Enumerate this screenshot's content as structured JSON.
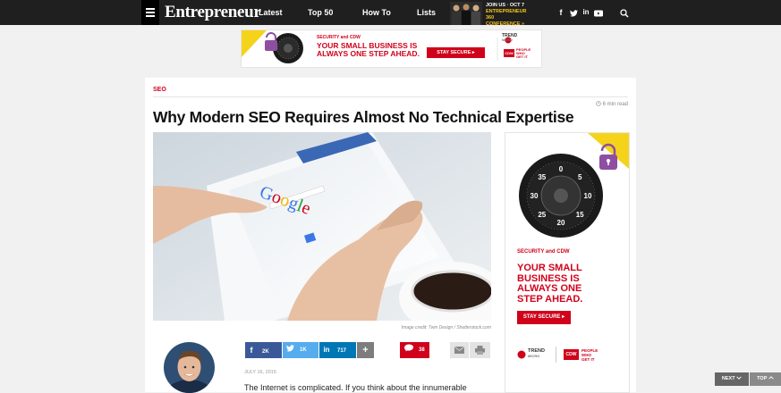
{
  "header": {
    "logo": "Entrepreneur",
    "nav": [
      "Latest",
      "Top 50",
      "How To",
      "Lists"
    ],
    "promo_line1": "JOIN US · OCT 7",
    "promo_line2": "ENTREPRENEUR 360",
    "promo_line3": "CONFERENCE »",
    "social_icons": [
      "facebook-icon",
      "twitter-icon",
      "linkedin-icon",
      "youtube-icon"
    ],
    "search_icon": "search-icon"
  },
  "top_ad": {
    "brand_line": "SECURITY and CDW",
    "headline_1": "YOUR SMALL BUSINESS IS",
    "headline_2": "ALWAYS ONE STEP AHEAD.",
    "cta": "STAY SECURE",
    "trend_1": "TREND",
    "trend_2": "MICRO",
    "cdw": "CDW",
    "tagline_1": "PEOPLE",
    "tagline_2": "WHO",
    "tagline_3": "GET IT"
  },
  "article": {
    "category": "SEO",
    "read_time": "6 min read",
    "title": "Why Modern SEO Requires Almost No Technical Expertise",
    "image_credit": "Image credit: Twin Design / Shutterstock.com",
    "date": "JULY 16, 2015",
    "first_line": "The Internet is complicated. If you think about the innumerable"
  },
  "share": {
    "facebook": "2K",
    "twitter": "1K",
    "linkedin": "717",
    "more": "+",
    "comments": "38"
  },
  "side_ad": {
    "brand": "SECURITY and CDW",
    "h1": "YOUR SMALL",
    "h2": "BUSINESS IS",
    "h3": "ALWAYS ONE",
    "h4": "STEP AHEAD.",
    "cta": "STAY SECURE",
    "trend_1": "TREND",
    "trend_2": "MICRO",
    "cdw": "CDW",
    "tagline_1": "PEOPLE",
    "tagline_2": "WHO",
    "tagline_3": "GET IT",
    "dial_numbers": [
      "0",
      "5",
      "10",
      "15",
      "20",
      "25",
      "30",
      "35"
    ]
  },
  "scroll": {
    "next": "NEXT",
    "top": "TOP"
  },
  "colors": {
    "accent": "#d0021b",
    "facebook": "#3b5998",
    "twitter": "#55acee",
    "linkedin": "#0077b5",
    "header": "#1f1f1f",
    "ad_yellow": "#f5d31a",
    "lock_purple": "#8e4fa3"
  }
}
